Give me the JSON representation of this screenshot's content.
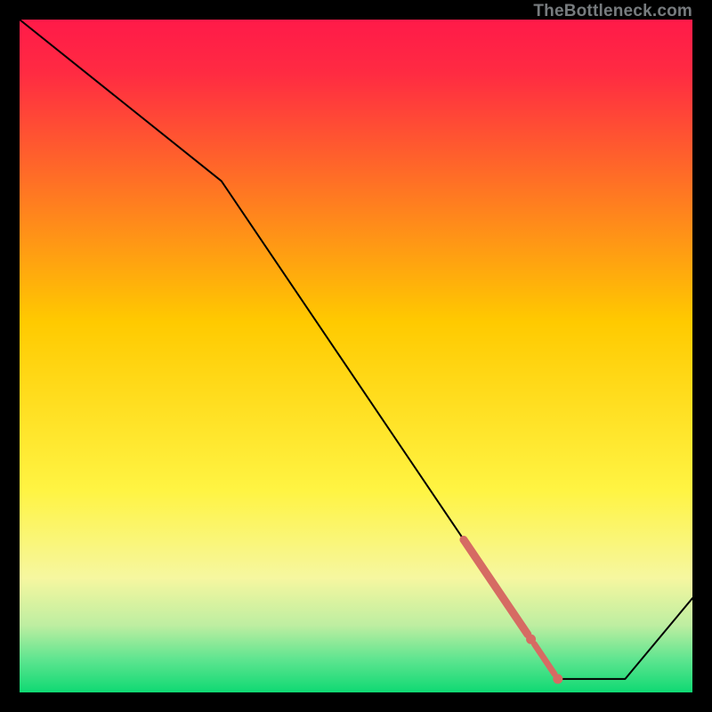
{
  "watermark": "TheBottleneck.com",
  "chart_data": {
    "type": "line",
    "title": "",
    "xlabel": "",
    "ylabel": "",
    "xlim": [
      0,
      100
    ],
    "ylim": [
      0,
      100
    ],
    "grid": false,
    "legend": false,
    "annotations": [],
    "series": [
      {
        "name": "bottleneck-curve",
        "color": "#000000",
        "x": [
          0,
          30,
          80,
          90,
          100
        ],
        "y": [
          100,
          76,
          2,
          2,
          14
        ]
      },
      {
        "name": "highlight-segment-thick",
        "color": "#d66b63",
        "stroke_width": 9,
        "x": [
          66,
          75.5
        ],
        "y": [
          22.7,
          8.65
        ]
      },
      {
        "name": "highlight-segment-mid",
        "color": "#d66b63",
        "stroke_width": 7,
        "x": [
          76.5,
          79.5
        ],
        "y": [
          7.2,
          2.74
        ]
      },
      {
        "name": "highlight-dot",
        "color": "#d66b63",
        "type_override": "scatter",
        "x": [
          76,
          80
        ],
        "y": [
          7.9,
          2
        ]
      }
    ],
    "background_gradient": {
      "top_color": "#ff1a49",
      "mid_colors": [
        "#ffca00",
        "#f6f7a0",
        "#3fe28d"
      ],
      "bottom_color": "#0fd973"
    }
  }
}
